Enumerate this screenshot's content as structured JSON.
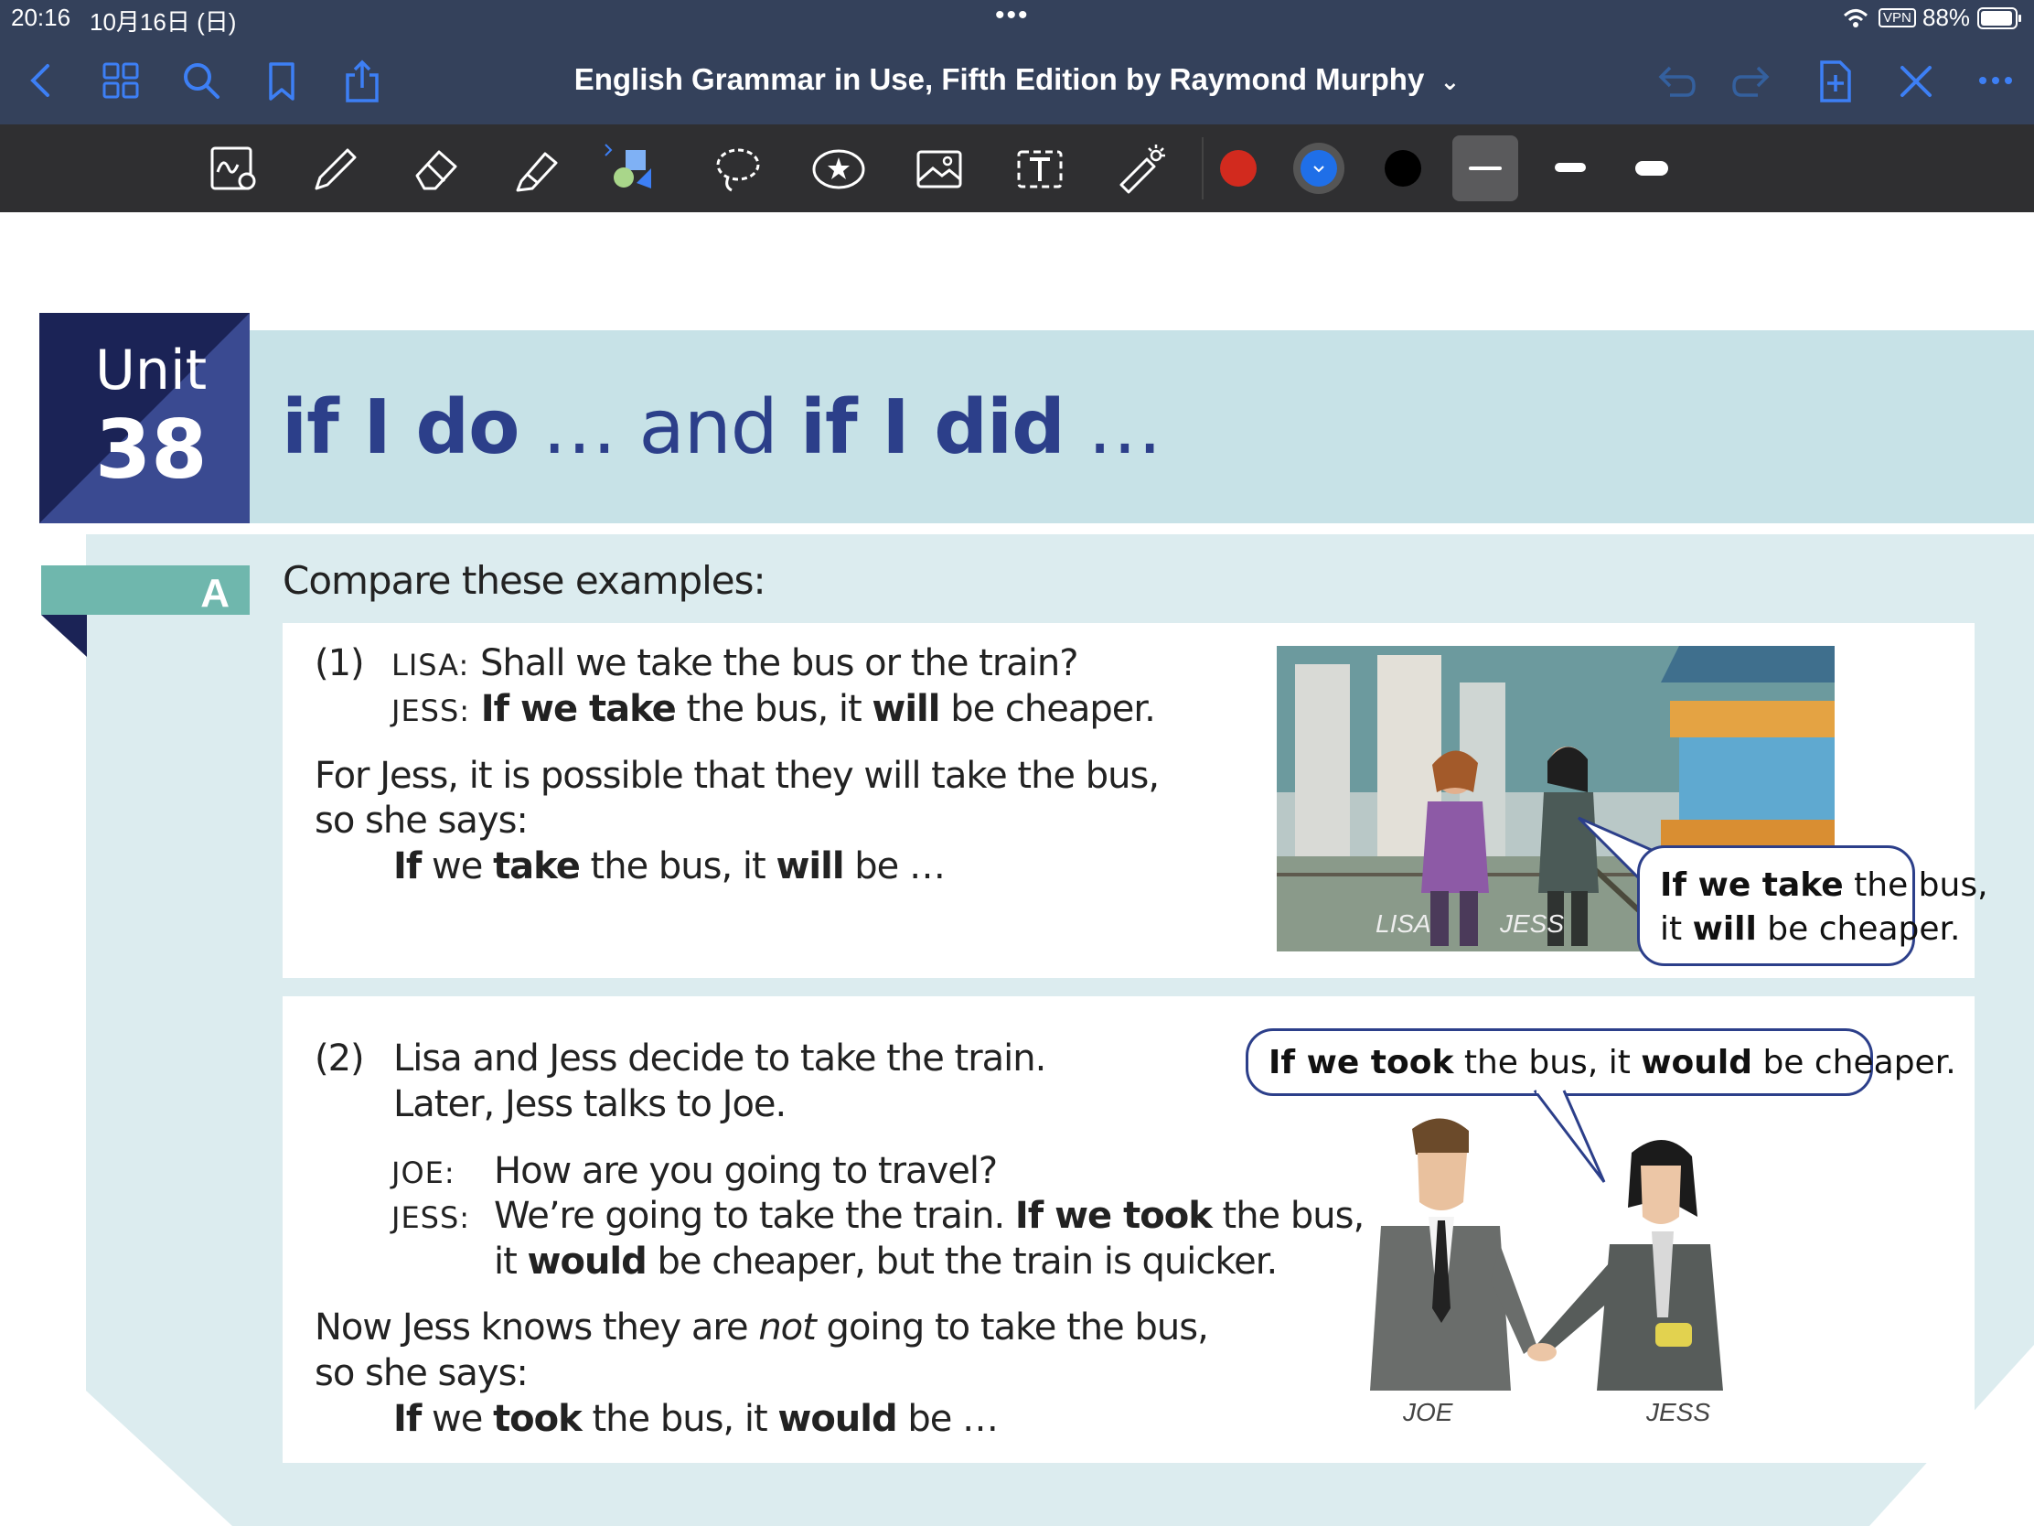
{
  "status": {
    "time": "20:16",
    "date": "10月16日 (日)",
    "dots": "•••",
    "vpn": "VPN",
    "battery": "88%"
  },
  "nav": {
    "title": "English Grammar in Use, Fifth Edition by Raymond Murphy",
    "dropdown_glyph": "⌄"
  },
  "toolbar": {
    "colors": [
      "#d22a1e",
      "#1f6fe8",
      "#000000"
    ]
  },
  "unit": {
    "label": "Unit",
    "number": "38"
  },
  "heading": {
    "part1": "if I do",
    "part2": " … and ",
    "part3": "if I did",
    "part4": " …"
  },
  "section": {
    "letter": "A",
    "intro": "Compare these examples:",
    "ex1": {
      "num": "(1)",
      "lisa_speaker": "LISA:",
      "lisa_line": "Shall we take the bus or the train?",
      "jess_speaker": "JESS:",
      "jess_if": "If we take",
      "jess_mid": " the bus, it ",
      "jess_will": "will",
      "jess_end": " be cheaper.",
      "expl1": "For Jess, it is possible that they will take the bus,",
      "expl2": "so she says:",
      "pattern_if": "If",
      "pattern_we": " we ",
      "pattern_take": "take",
      "pattern_mid": " the bus, it ",
      "pattern_will": "will",
      "pattern_end": " be …",
      "bubble_if": "If we take",
      "bubble_rest1": " the bus,",
      "bubble_it": "it ",
      "bubble_will": "will",
      "bubble_end": " be cheaper.",
      "cap_lisa": "LISA",
      "cap_jess": "JESS"
    },
    "ex2": {
      "num": "(2)",
      "line1": "Lisa and Jess decide to take the train.",
      "line2": "Later, Jess talks to Joe.",
      "joe_speaker": "JOE:",
      "joe_line": "How are you going to travel?",
      "jess_speaker": "JESS:",
      "jess_a": "We’re going to take the train.  ",
      "jess_if": "If we took",
      "jess_b": " the bus,",
      "jess_c": "it ",
      "jess_would": "would",
      "jess_d": " be cheaper, but the train is quicker.",
      "expl1a": "Now Jess knows they are ",
      "expl1_not": "not",
      "expl1b": " going to take the bus,",
      "expl2": "so she says:",
      "pattern_if": "If",
      "pattern_we": " we ",
      "pattern_took": "took",
      "pattern_mid": " the bus, it ",
      "pattern_would": "would",
      "pattern_end": " be …",
      "bubble_if": "If we took",
      "bubble_mid": " the bus, it ",
      "bubble_would": "would",
      "bubble_end": " be cheaper.",
      "cap_joe": "JOE",
      "cap_jess": "JESS"
    }
  }
}
